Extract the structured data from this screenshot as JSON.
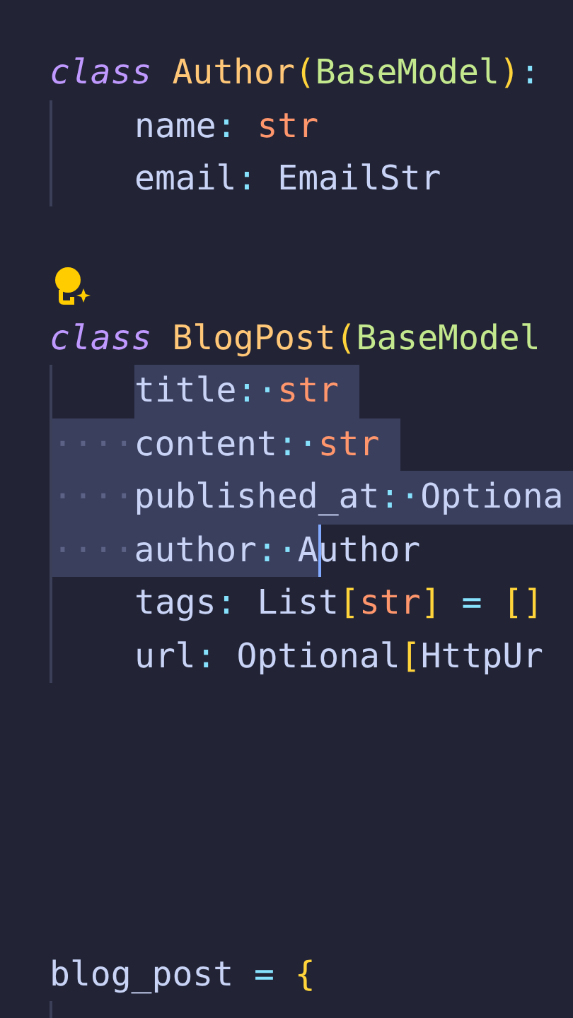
{
  "editor": {
    "lines": [
      {
        "tokens": [
          {
            "kind": "keyword",
            "text": "class "
          },
          {
            "kind": "classname",
            "text": "Author"
          },
          {
            "kind": "bracket",
            "text": "("
          },
          {
            "kind": "base",
            "text": "BaseModel"
          },
          {
            "kind": "bracket",
            "text": ")"
          },
          {
            "kind": "operator",
            "text": ":"
          }
        ]
      },
      {
        "indented": true,
        "tokens": [
          {
            "kind": "plain",
            "text": "name"
          },
          {
            "kind": "operator",
            "text": ": "
          },
          {
            "kind": "builtin",
            "text": "str"
          }
        ]
      },
      {
        "indented": true,
        "tokens": [
          {
            "kind": "plain",
            "text": "email"
          },
          {
            "kind": "operator",
            "text": ": "
          },
          {
            "kind": "plain",
            "text": "EmailStr"
          }
        ]
      },
      {
        "kind": "blank"
      },
      {
        "kind": "hint"
      },
      {
        "tokens": [
          {
            "kind": "keyword",
            "text": "class "
          },
          {
            "kind": "classname",
            "text": "BlogPost"
          },
          {
            "kind": "bracket",
            "text": "("
          },
          {
            "kind": "base",
            "text": "BaseModel"
          }
        ]
      },
      {
        "indented": true,
        "tokens": [
          {
            "kind": "plain",
            "text": "title",
            "selected": true
          },
          {
            "kind": "operator",
            "text": ":·",
            "selected": true
          },
          {
            "kind": "builtin",
            "text": "str ",
            "selected": true
          }
        ]
      },
      {
        "indented": true,
        "tokens": [
          {
            "kind": "whitespace",
            "text": "····",
            "selected": true
          },
          {
            "kind": "plain",
            "text": "content",
            "selected": true
          },
          {
            "kind": "operator",
            "text": ":·",
            "selected": true
          },
          {
            "kind": "builtin",
            "text": "str ",
            "selected": true
          }
        ]
      },
      {
        "indented": true,
        "selection_continues": true,
        "tokens": [
          {
            "kind": "whitespace",
            "text": "····",
            "selected": true
          },
          {
            "kind": "plain",
            "text": "published_at",
            "selected": true
          },
          {
            "kind": "operator",
            "text": ":·",
            "selected": true
          },
          {
            "kind": "plain",
            "text": "Optiona",
            "selected": true
          }
        ]
      },
      {
        "indented": true,
        "tokens": [
          {
            "kind": "whitespace",
            "text": "····",
            "selected": true
          },
          {
            "kind": "plain",
            "text": "author",
            "selected": true
          },
          {
            "kind": "operator",
            "text": ":·",
            "selected": true
          },
          {
            "kind": "plain",
            "text": "A",
            "selected": true
          },
          {
            "kind": "plain",
            "text": "uthor",
            "selected": false,
            "cursor_before": true
          }
        ]
      },
      {
        "indented": true,
        "tokens": [
          {
            "kind": "plain",
            "text": "tags"
          },
          {
            "kind": "operator",
            "text": ": "
          },
          {
            "kind": "plain",
            "text": "List"
          },
          {
            "kind": "bracket",
            "text": "["
          },
          {
            "kind": "builtin",
            "text": "str"
          },
          {
            "kind": "bracket",
            "text": "]"
          },
          {
            "kind": "operator",
            "text": " = "
          },
          {
            "kind": "bracket",
            "text": "[]"
          }
        ]
      },
      {
        "indented": true,
        "tokens": [
          {
            "kind": "plain",
            "text": "url"
          },
          {
            "kind": "operator",
            "text": ": "
          },
          {
            "kind": "plain",
            "text": "Optional"
          },
          {
            "kind": "bracket",
            "text": "["
          },
          {
            "kind": "plain",
            "text": "HttpUr"
          }
        ]
      },
      {
        "kind": "blank"
      },
      {
        "kind": "blank"
      },
      {
        "kind": "blank"
      },
      {
        "kind": "blank"
      },
      {
        "kind": "blank"
      },
      {
        "tokens": [
          {
            "kind": "plain",
            "text": "blog_post"
          },
          {
            "kind": "operator",
            "text": " = "
          },
          {
            "kind": "bracket",
            "text": "{"
          }
        ]
      },
      {
        "kind": "blank",
        "indented": true
      }
    ]
  }
}
